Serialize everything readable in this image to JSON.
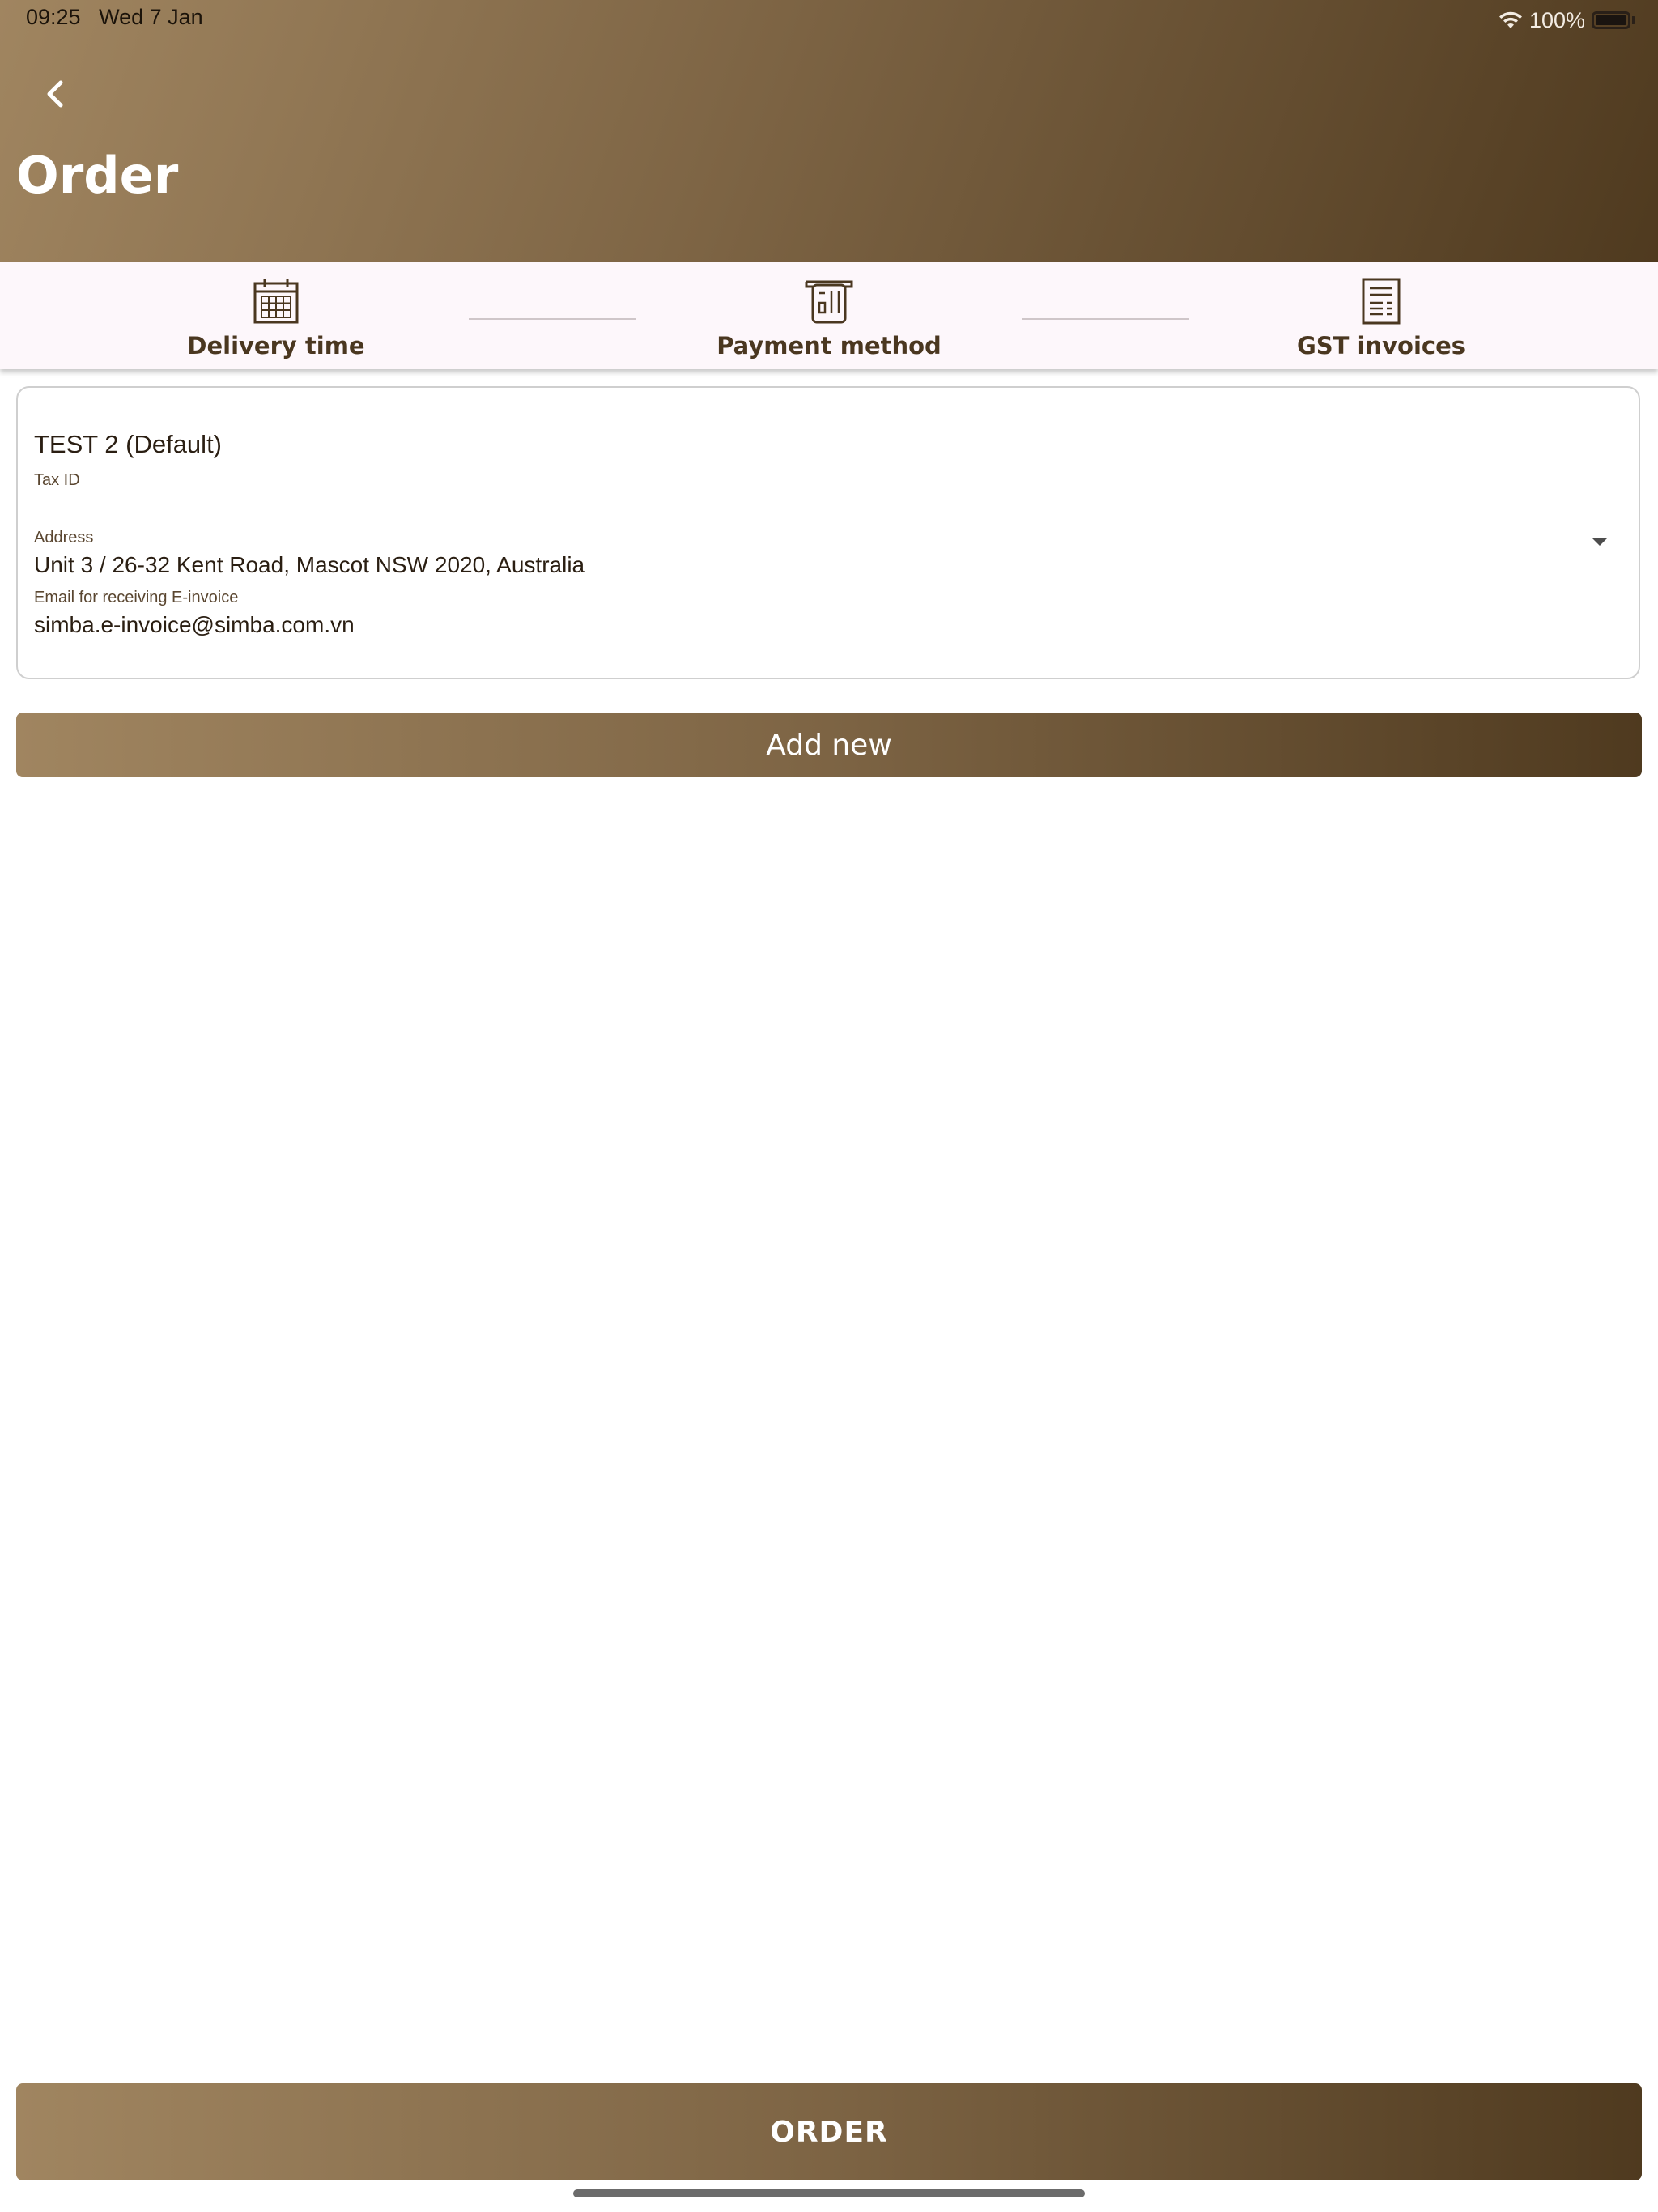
{
  "status_bar": {
    "time": "09:25",
    "date": "Wed 7 Jan",
    "battery": "100%"
  },
  "header": {
    "title": "Order"
  },
  "stepper": {
    "steps": [
      {
        "label": "Delivery time",
        "icon": "calendar-icon"
      },
      {
        "label": "Payment method",
        "icon": "payment-terminal-icon"
      },
      {
        "label": "GST invoices",
        "icon": "invoice-icon"
      }
    ]
  },
  "invoice": {
    "name": "TEST 2 (Default)",
    "tax_id_label": "Tax ID",
    "address_label": "Address",
    "address": "Unit 3 / 26-32 Kent Road, Mascot NSW 2020, Australia",
    "email_label": "Email for receiving E-invoice",
    "email": "simba.e-invoice@simba.com.vn"
  },
  "actions": {
    "add_new": "Add new",
    "order": "ORDER"
  },
  "colors": {
    "gradient_start": "#a08560",
    "gradient_end": "#4f3a1f",
    "step_text": "#4a3720",
    "stepper_bg": "#fdf7fb"
  }
}
